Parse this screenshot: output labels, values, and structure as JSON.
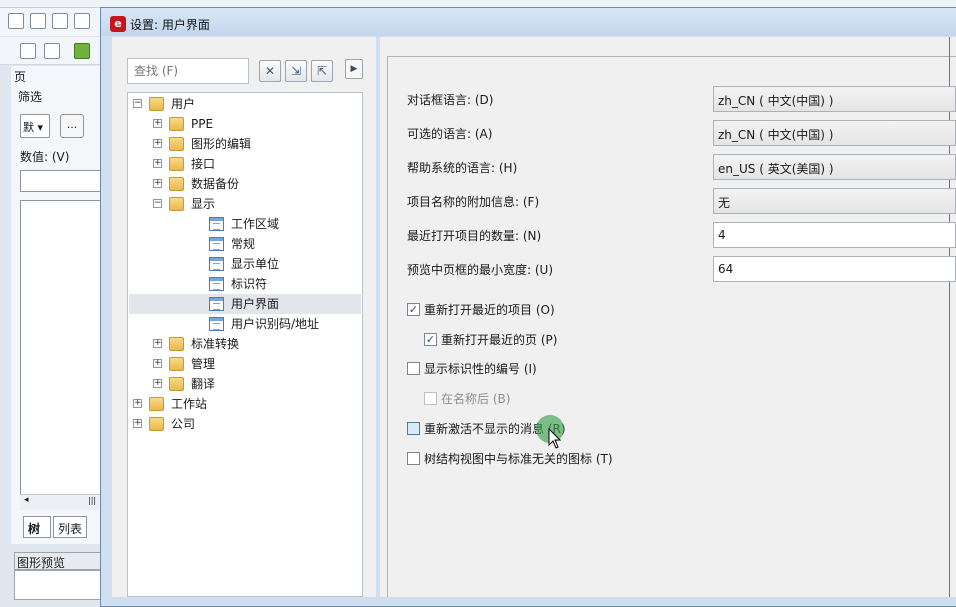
{
  "bg_app": {
    "panel_title": "页",
    "filter_label": "筛选",
    "select_value": "默",
    "ellipsis": "...",
    "value_label": "数值: (V)",
    "tabs": [
      "树",
      "列表"
    ],
    "preview_title": "图形预览",
    "scroll_thumb": "|||"
  },
  "dialog": {
    "title": "设置: 用户界面",
    "app_icon": "e",
    "search_placeholder": "查找 (F)",
    "play_glyph": "▶",
    "tree": [
      {
        "label": "用户",
        "type": "folder",
        "expander": "−",
        "level": 0
      },
      {
        "label": "PPE",
        "type": "folder",
        "expander": "+",
        "level": 1
      },
      {
        "label": "图形的编辑",
        "type": "folder",
        "expander": "+",
        "level": 1
      },
      {
        "label": "接口",
        "type": "folder",
        "expander": "+",
        "level": 1
      },
      {
        "label": "数据备份",
        "type": "folder",
        "expander": "+",
        "level": 1
      },
      {
        "label": "显示",
        "type": "folder",
        "expander": "−",
        "level": 1
      },
      {
        "label": "工作区域",
        "type": "page",
        "expander": "",
        "level": 2
      },
      {
        "label": "常规",
        "type": "page",
        "expander": "",
        "level": 2
      },
      {
        "label": "显示单位",
        "type": "page",
        "expander": "",
        "level": 2
      },
      {
        "label": "标识符",
        "type": "page",
        "expander": "",
        "level": 2
      },
      {
        "label": "用户界面",
        "type": "page",
        "expander": "",
        "level": 2,
        "selected": true
      },
      {
        "label": "用户识别码/地址",
        "type": "page",
        "expander": "",
        "level": 2
      },
      {
        "label": "标准转换",
        "type": "folder",
        "expander": "+",
        "level": 1
      },
      {
        "label": "管理",
        "type": "folder",
        "expander": "+",
        "level": 1
      },
      {
        "label": "翻译",
        "type": "folder",
        "expander": "+",
        "level": 1
      },
      {
        "label": "工作站",
        "type": "folder",
        "expander": "+",
        "level": 0
      },
      {
        "label": "公司",
        "type": "folder",
        "expander": "+",
        "level": 0
      }
    ],
    "settings": {
      "dialog_language": {
        "label": "对话框语言: (D)",
        "value": "zh_CN ( 中文(中国) )"
      },
      "optional_language": {
        "label": "可选的语言: (A)",
        "value": "zh_CN ( 中文(中国) )"
      },
      "help_language": {
        "label": "帮助系统的语言: (H)",
        "value": "en_US ( 英文(美国) )"
      },
      "item_name_info": {
        "label": "项目名称的附加信息: (F)",
        "value": "无"
      },
      "recent_count": {
        "label": "最近打开项目的数量: (N)",
        "value": "4"
      },
      "preview_min_width": {
        "label": "预览中页框的最小宽度: (U)",
        "value": "64"
      }
    },
    "checkboxes": [
      {
        "label": "重新打开最近的项目 (O)",
        "checked": true,
        "disabled": false
      },
      {
        "label": "重新打开最近的页 (P)",
        "checked": true,
        "disabled": false
      },
      {
        "label": "显示标识性的编号 (I)",
        "checked": false,
        "disabled": false
      },
      {
        "label": "在名称后 (B)",
        "checked": false,
        "disabled": true
      },
      {
        "label": "重新激活不显示的消息 (R)",
        "checked": false,
        "disabled": false
      },
      {
        "label": "树结构视图中与标准无关的图标 (T)",
        "checked": false,
        "disabled": false
      }
    ],
    "check_glyph": "✓"
  }
}
